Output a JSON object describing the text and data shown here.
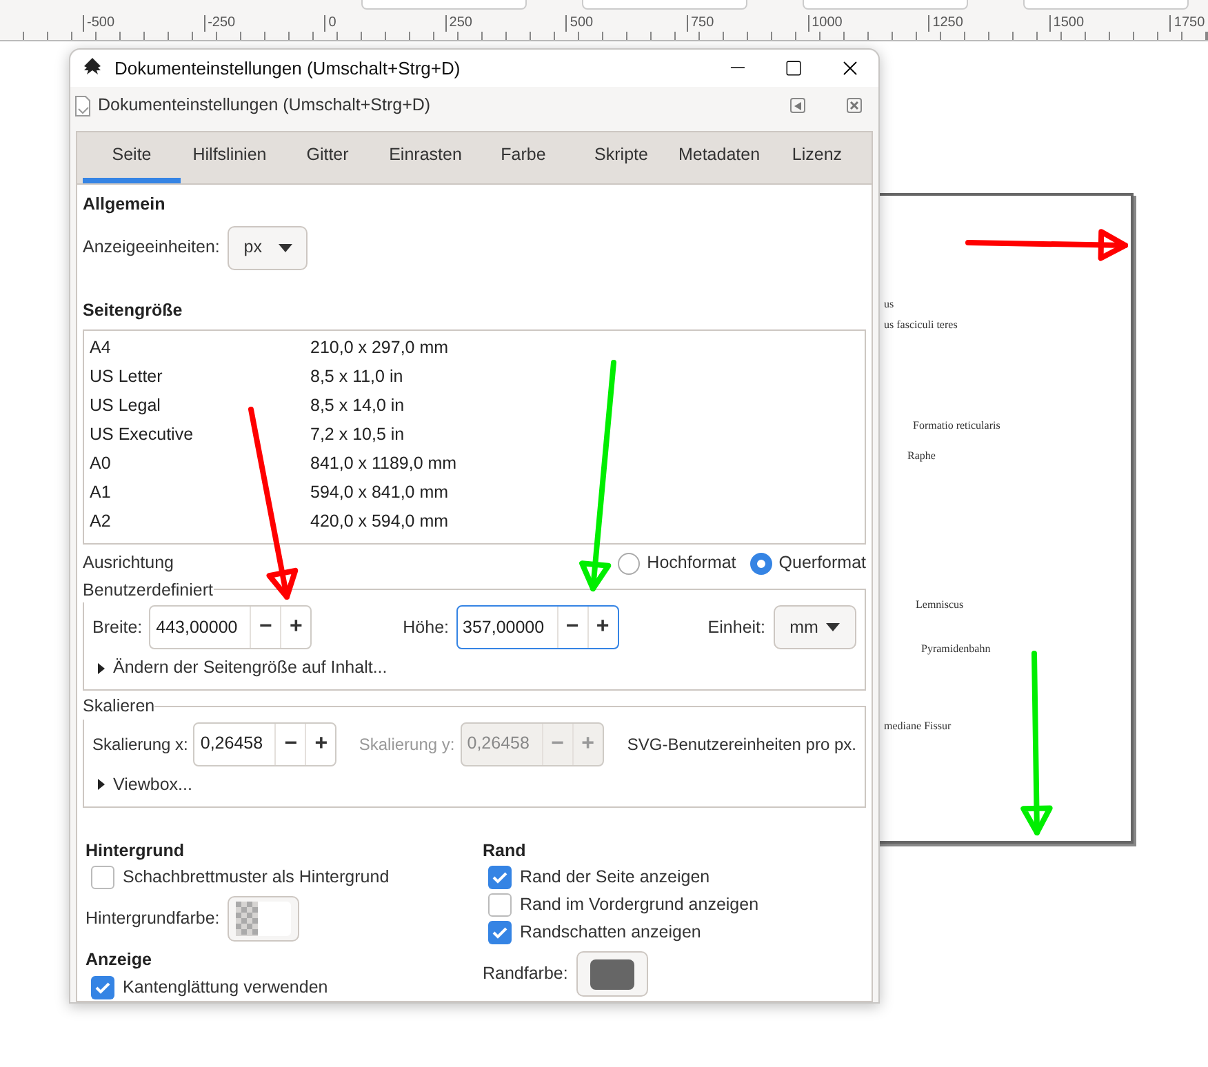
{
  "ruler": {
    "labels": [
      "-500",
      "-250",
      "0",
      "250",
      "500",
      "750",
      "1000",
      "1250",
      "1500",
      "1750"
    ]
  },
  "canvas_page": {
    "labels": [
      "us",
      "us fasciculi teres",
      "Formatio reticularis",
      "Raphe",
      "Lemniscus",
      "Pyramidenbahn",
      "mediane Fissur"
    ]
  },
  "window": {
    "title": "Dokumenteinstellungen (Umschalt+Strg+D)"
  },
  "panel": {
    "title": "Dokumenteinstellungen (Umschalt+Strg+D)"
  },
  "tabs": [
    {
      "label": "Seite",
      "selected": true
    },
    {
      "label": "Hilfslinien",
      "selected": false
    },
    {
      "label": "Gitter",
      "selected": false
    },
    {
      "label": "Einrasten",
      "selected": false
    },
    {
      "label": "Farbe",
      "selected": false
    },
    {
      "label": "Skripte",
      "selected": false
    },
    {
      "label": "Metadaten",
      "selected": false
    },
    {
      "label": "Lizenz",
      "selected": false
    }
  ],
  "general": {
    "heading": "Allgemein",
    "units_label": "Anzeigeeinheiten:",
    "units_value": "px"
  },
  "page_size": {
    "heading": "Seitengröße",
    "rows": [
      {
        "name": "A4",
        "size": "210,0 x 297,0 mm"
      },
      {
        "name": "US Letter",
        "size": "8,5 x 11,0 in"
      },
      {
        "name": "US Legal",
        "size": "8,5 x 14,0 in"
      },
      {
        "name": "US Executive",
        "size": "7,2 x 10,5 in"
      },
      {
        "name": "A0",
        "size": "841,0 x 1189,0 mm"
      },
      {
        "name": "A1",
        "size": "594,0 x 841,0 mm"
      },
      {
        "name": "A2",
        "size": "420,0 x 594,0 mm"
      }
    ]
  },
  "orientation": {
    "label": "Ausrichtung",
    "options": [
      {
        "label": "Hochformat",
        "selected": false
      },
      {
        "label": "Querformat",
        "selected": true
      }
    ]
  },
  "custom": {
    "legend": "Benutzerdefiniert",
    "width": {
      "label": "Breite:",
      "value": "443,00000",
      "focused": false,
      "disabled": false
    },
    "height": {
      "label": "Höhe:",
      "value": "357,00000",
      "focused": true,
      "disabled": false
    },
    "unit_label": "Einheit:",
    "unit_value": "mm",
    "expander": "Ändern der Seitengröße auf Inhalt..."
  },
  "scale": {
    "legend": "Skalieren",
    "x": {
      "label": "Skalierung x:",
      "value": "0,26458",
      "focused": false,
      "disabled": false
    },
    "y": {
      "label": "Skalierung y:",
      "value": "0,26458",
      "focused": false,
      "disabled": true
    },
    "note": "SVG-Benutzereinheiten pro px.",
    "expander": "Viewbox..."
  },
  "spin_symbols": {
    "minus": "−",
    "plus": "+"
  },
  "background": {
    "heading": "Hintergrund",
    "checkboxes": [
      {
        "label": "Schachbrettmuster als Hintergrund",
        "checked": false
      }
    ],
    "color_label": "Hintergrundfarbe:"
  },
  "display": {
    "heading": "Anzeige",
    "checkboxes": [
      {
        "label": "Kantenglättung verwenden",
        "checked": true
      }
    ]
  },
  "border": {
    "heading": "Rand",
    "checkboxes": [
      {
        "label": "Rand der Seite anzeigen",
        "checked": true
      },
      {
        "label": "Rand im Vordergrund anzeigen",
        "checked": false
      },
      {
        "label": "Randschatten anzeigen",
        "checked": true
      }
    ],
    "color_label": "Randfarbe:",
    "color": "#666666"
  },
  "annotations": [
    {
      "color": "#ff0000"
    },
    {
      "color": "#00ee00"
    },
    {
      "color": "#ff0000"
    },
    {
      "color": "#00ee00"
    }
  ]
}
